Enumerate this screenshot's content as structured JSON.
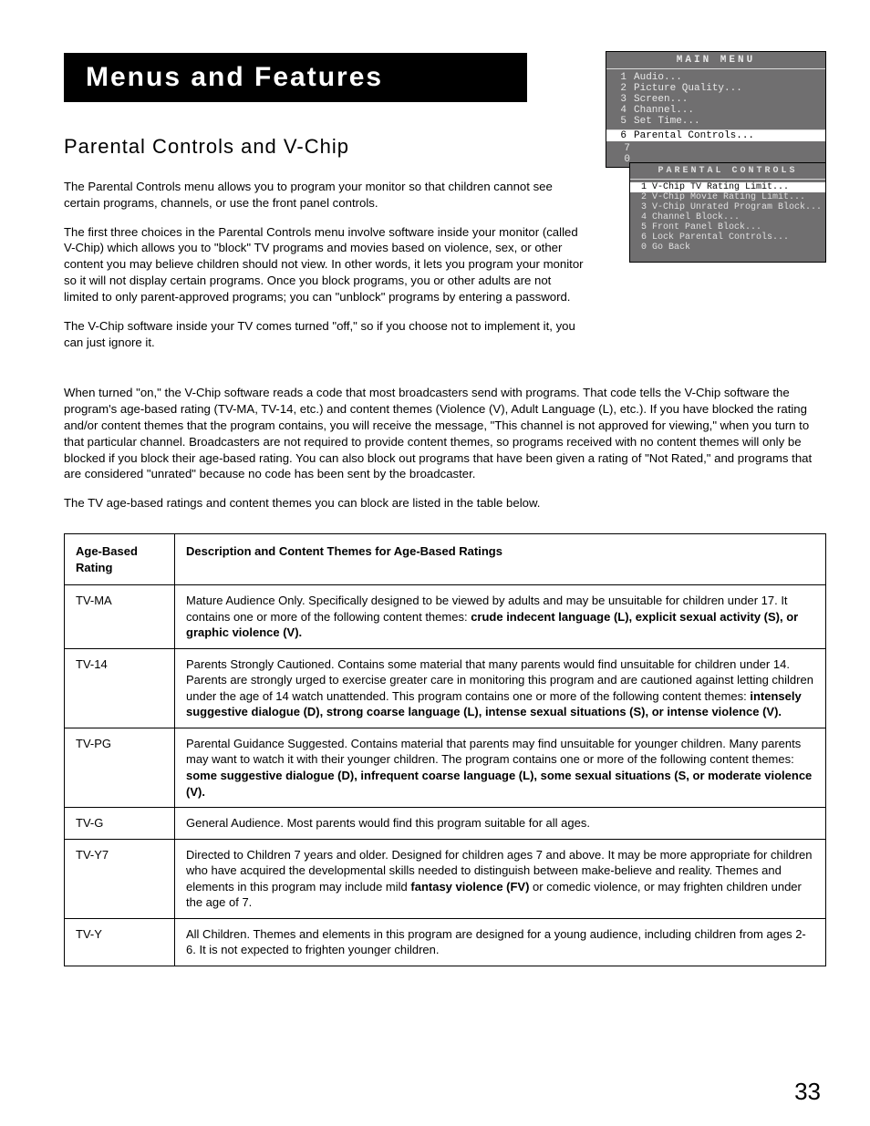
{
  "banner": "Menus and Features",
  "section_title": "Parental Controls and V-Chip",
  "paras": {
    "p1": "The Parental Controls menu allows you to program your monitor so that children cannot see certain programs, channels, or use the front panel controls.",
    "p2": "The first three choices in the Parental Controls menu involve software inside your monitor (called V-Chip) which allows you to \"block\" TV programs and movies based on violence, sex, or other content you may believe children should not view. In other words, it lets you program your monitor so it will not display certain programs. Once you block programs, you or other adults are not limited to only parent-approved programs; you can \"unblock\" programs by entering a password.",
    "p3": "The V-Chip software inside your TV comes turned \"off,\" so if you choose not to implement it, you can just ignore it.",
    "p4": "When turned \"on,\" the V-Chip software reads a code that most broadcasters send with programs. That code tells the V-Chip software the program's age-based rating (TV-MA, TV-14, etc.) and content themes (Violence (V), Adult Language (L), etc.). If you have blocked the rating and/or content themes that the program contains, you will receive the message, \"This channel is not approved for viewing,\" when you turn to that particular channel. Broadcasters are not required to provide content themes, so programs received with no content themes will only be blocked if you block their age-based rating. You can also block out programs that have been given a rating of \"Not Rated,\" and programs that are considered \"unrated\" because no code has been sent by the broadcaster.",
    "p5": "The TV age-based ratings and content themes you can block are listed in the table below."
  },
  "osd_main": {
    "title": "MAIN MENU",
    "items": [
      {
        "n": "1",
        "label": "Audio..."
      },
      {
        "n": "2",
        "label": "Picture Quality..."
      },
      {
        "n": "3",
        "label": "Screen..."
      },
      {
        "n": "4",
        "label": "Channel..."
      },
      {
        "n": "5",
        "label": "Set Time..."
      },
      {
        "n": "6",
        "label": "Parental Controls...",
        "selected": true
      },
      {
        "n": "7",
        "label": ""
      },
      {
        "n": "0",
        "label": ""
      }
    ]
  },
  "osd_sub": {
    "title": "PARENTAL CONTROLS",
    "items": [
      {
        "n": "1",
        "label": "V-Chip TV Rating Limit...",
        "selected": true
      },
      {
        "n": "2",
        "label": "V-Chip Movie Rating Limit..."
      },
      {
        "n": "3",
        "label": "V-Chip Unrated Program Block..."
      },
      {
        "n": "4",
        "label": "Channel Block..."
      },
      {
        "n": "5",
        "label": "Front Panel Block..."
      },
      {
        "n": "6",
        "label": "Lock Parental Controls..."
      },
      {
        "n": "0",
        "label": "Go Back"
      }
    ]
  },
  "table": {
    "head": {
      "col1": "Age-Based Rating",
      "col2": "Description and Content Themes for Age-Based Ratings"
    },
    "rows": [
      {
        "rating": "TV-MA",
        "desc_plain": "Mature Audience Only. Specifically designed to be viewed by adults and may be unsuitable for children under 17.  It contains one or more of the following content themes:  ",
        "desc_bold": "crude indecent language (L), explicit sexual activity (S), or graphic violence (V)."
      },
      {
        "rating": "TV-14",
        "desc_plain": "Parents Strongly Cautioned. Contains some material that many parents would find unsuitable for children under 14.  Parents are strongly urged to exercise greater care in monitoring this program and are cautioned against letting children under the age of 14 watch unattended.  This program contains one or more of the following content themes:  ",
        "desc_bold": "intensely suggestive dialogue (D), strong coarse language (L), intense sexual situations (S), or intense violence (V)."
      },
      {
        "rating": "TV-PG",
        "desc_plain": "Parental Guidance Suggested. Contains material that parents may find unsuitable for younger children.  Many parents may want to watch it with their younger children.  The program contains one or more of the following content themes:  ",
        "desc_bold": "some suggestive dialogue (D), infrequent coarse language (L), some sexual situations (S, or moderate violence (V)."
      },
      {
        "rating": "TV-G",
        "desc_plain": "General Audience. Most parents would find this program suitable for all ages.",
        "desc_bold": ""
      },
      {
        "rating": "TV-Y7",
        "desc_pre": "Directed to Children 7 years and older. Designed for children ages 7 and above.  It may be more appropriate for children who have acquired the developmental skills needed to distinguish between make-believe and reality.  Themes and elements in this program may include mild ",
        "desc_mid_bold": "fantasy violence (FV)",
        "desc_post": " or comedic violence, or may frighten children under the age of 7."
      },
      {
        "rating": "TV-Y",
        "desc_plain": "All Children. Themes and elements in this program are designed for a young audience, including children from ages 2-6.  It is not expected to frighten younger children.",
        "desc_bold": ""
      }
    ]
  },
  "page_number": "33"
}
